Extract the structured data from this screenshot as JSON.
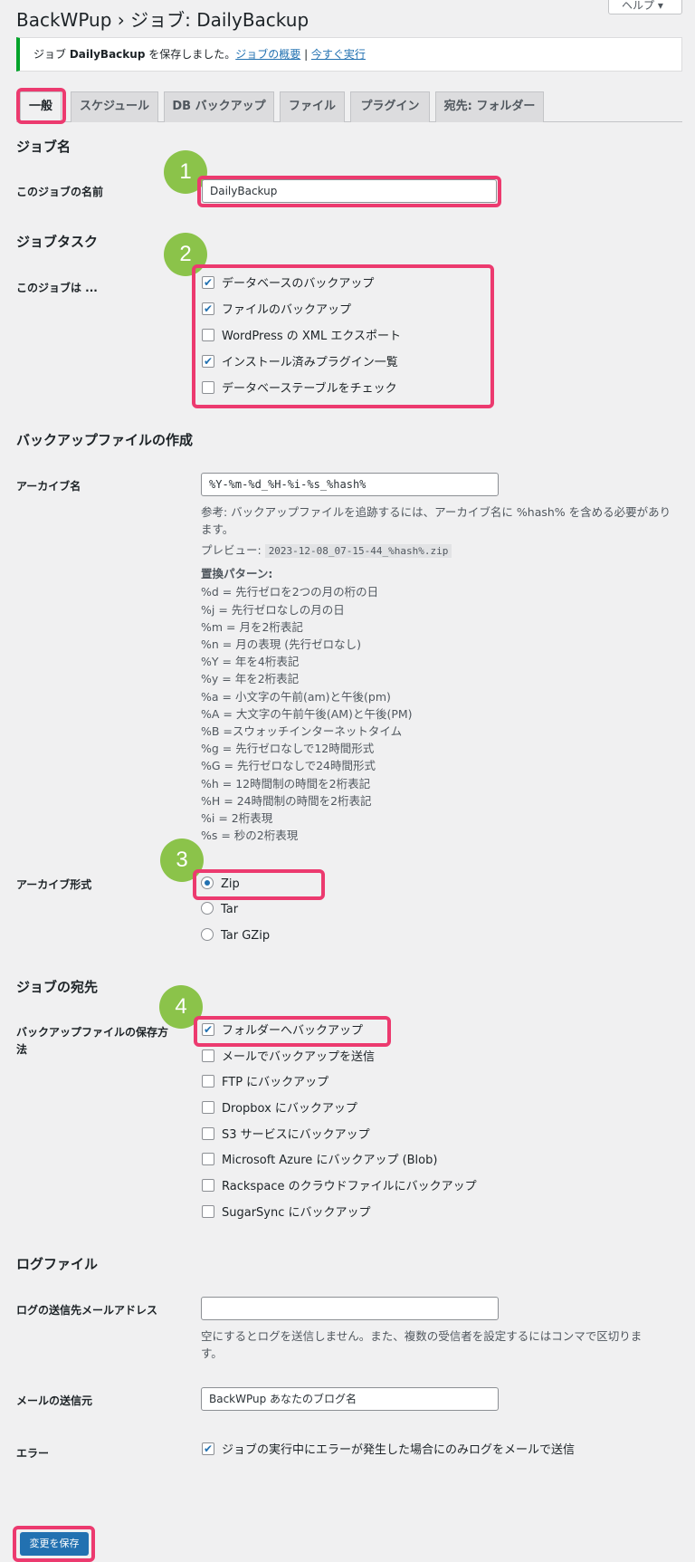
{
  "header": {
    "title": "BackWPup › ジョブ: DailyBackup",
    "help_label": "ヘルプ ▾"
  },
  "notice": {
    "prefix": "ジョブ ",
    "job": "DailyBackup",
    "suffix": " を保存しました。",
    "link1": "ジョブの概要",
    "sep": " | ",
    "link2": "今すぐ実行"
  },
  "tabs": [
    {
      "label": "一般"
    },
    {
      "label": "スケジュール"
    },
    {
      "label": "DB バックアップ"
    },
    {
      "label": "ファイル"
    },
    {
      "label": "プラグイン"
    },
    {
      "label": "宛先: フォルダー"
    }
  ],
  "badges": [
    "1",
    "2",
    "3",
    "4"
  ],
  "job_name": {
    "heading": "ジョブ名",
    "label": "このジョブの名前",
    "value": "DailyBackup"
  },
  "job_tasks": {
    "heading": "ジョブタスク",
    "label": "このジョブは ...",
    "items": [
      {
        "label": "データベースのバックアップ",
        "checked": true
      },
      {
        "label": "ファイルのバックアップ",
        "checked": true
      },
      {
        "label": "WordPress の XML エクスポート",
        "checked": false
      },
      {
        "label": "インストール済みプラグイン一覧",
        "checked": true
      },
      {
        "label": "データベーステーブルをチェック",
        "checked": false
      }
    ]
  },
  "archive": {
    "heading": "バックアップファイルの作成",
    "name_label": "アーカイブ名",
    "name_value": "%Y-%m-%d_%H-%i-%s_%hash%",
    "note_line1": "参考: バックアップファイルを追跡するには、アーカイブ名に %hash% を含める必要があり",
    "note_line2": "ます。",
    "preview_label": "プレビュー: ",
    "preview_value": "2023-12-08_07-15-44_%hash%.zip",
    "patterns_heading": "置換パターン:",
    "patterns": [
      "%d = 先行ゼロを2つの月の桁の日",
      "%j = 先行ゼロなしの月の日",
      "%m = 月を2桁表記",
      "%n = 月の表現 (先行ゼロなし)",
      "%Y = 年を4桁表記",
      "%y = 年を2桁表記",
      "%a = 小文字の午前(am)と午後(pm)",
      "%A = 大文字の午前午後(AM)と午後(PM)",
      "%B =スウォッチインターネットタイム",
      "%g = 先行ゼロなしで12時間形式",
      "%G = 先行ゼロなしで24時間形式",
      "%h = 12時間制の時間を2桁表記",
      "%H = 24時間制の時間を2桁表記",
      "%i = 2桁表現",
      "%s = 秒の2桁表現"
    ],
    "format_label": "アーカイブ形式",
    "formats": [
      {
        "label": "Zip",
        "selected": true
      },
      {
        "label": "Tar",
        "selected": false
      },
      {
        "label": "Tar GZip",
        "selected": false
      }
    ]
  },
  "destination": {
    "heading": "ジョブの宛先",
    "label_line1": "バックアップファイルの保存方",
    "label_line2": "法",
    "items": [
      {
        "label": "フォルダーへバックアップ",
        "checked": true
      },
      {
        "label": "メールでバックアップを送信",
        "checked": false
      },
      {
        "label": "FTP にバックアップ",
        "checked": false
      },
      {
        "label": "Dropbox にバックアップ",
        "checked": false
      },
      {
        "label": "S3 サービスにバックアップ",
        "checked": false
      },
      {
        "label": "Microsoft Azure にバックアップ (Blob)",
        "checked": false
      },
      {
        "label": "Rackspace のクラウドファイルにバックアップ",
        "checked": false
      },
      {
        "label": "SugarSync にバックアップ",
        "checked": false
      }
    ]
  },
  "log": {
    "heading": "ログファイル",
    "email_label": "ログの送信先メールアドレス",
    "email_value": "",
    "email_note_line1": "空にするとログを送信しません。また、複数の受信者を設定するにはコンマで区切りま",
    "email_note_line2": "す。",
    "from_label": "メールの送信元",
    "from_value": "BackWPup あなたのブログ名",
    "error_label": "エラー",
    "error_option": "ジョブの実行中にエラーが発生した場合にのみログをメールで送信",
    "error_checked": true
  },
  "save_label": "変更を保存"
}
